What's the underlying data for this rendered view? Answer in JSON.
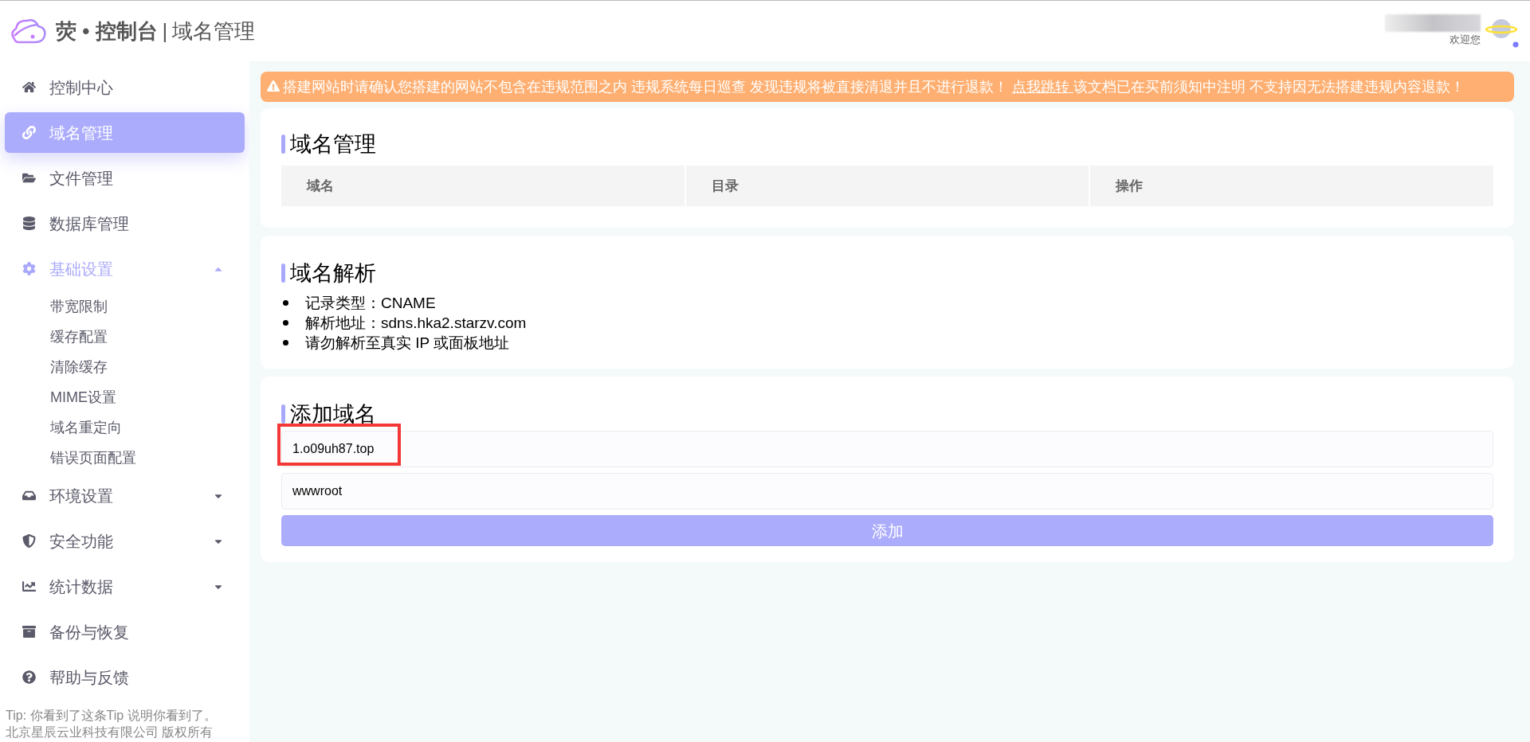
{
  "header": {
    "brand": "荧 • 控制台",
    "separator": "|",
    "page_title": "域名管理",
    "welcome": "欢迎您"
  },
  "sidebar": {
    "items": [
      {
        "kind": "link",
        "label": "控制中心",
        "selected": false
      },
      {
        "kind": "link",
        "label": "域名管理",
        "selected": true
      },
      {
        "kind": "link",
        "label": "文件管理",
        "selected": false
      },
      {
        "kind": "link",
        "label": "数据库管理",
        "selected": false
      },
      {
        "kind": "group",
        "label": "基础设置",
        "selected": false,
        "expanded": true,
        "children": [
          {
            "label": "带宽限制"
          },
          {
            "label": "缓存配置"
          },
          {
            "label": "清除缓存"
          },
          {
            "label": "MIME设置"
          },
          {
            "label": "域名重定向"
          },
          {
            "label": "错误页面配置"
          }
        ]
      },
      {
        "kind": "group",
        "label": "环境设置",
        "selected": false,
        "expanded": false
      },
      {
        "kind": "group",
        "label": "安全功能",
        "selected": false,
        "expanded": false
      },
      {
        "kind": "group",
        "label": "统计数据",
        "selected": false,
        "expanded": false
      },
      {
        "kind": "link",
        "label": "备份与恢复",
        "selected": false
      },
      {
        "kind": "link",
        "label": "帮助与反馈",
        "selected": false
      }
    ],
    "footer": [
      "Tip: 你看到了这条Tip 说明你看到了。",
      "北京星辰云业科技有限公司 版权所有"
    ]
  },
  "notice": {
    "text_before": "搭建网站时请确认您搭建的网站不包含在违规范围之内 违规系统每日巡查 发现违规将被直接清退并且不进行退款！",
    "link": "点我跳转 ",
    "text_after": "该文档已在买前须知中注明 不支持因无法搭建违规内容退款！"
  },
  "domain_table": {
    "title": "域名管理",
    "columns": [
      "域名",
      "目录",
      "操作"
    ]
  },
  "resolve": {
    "title": "域名解析",
    "items": [
      "记录类型：CNAME",
      "解析地址：sdns.hka2.starzv.com",
      "请勿解析至真实 IP 或面板地址"
    ]
  },
  "add_domain": {
    "title": "添加域名",
    "fields": [
      {
        "value": "1.o09uh87.top",
        "highlighted": true
      },
      {
        "value": "wwwroot",
        "highlighted": false
      }
    ],
    "button": "添加"
  }
}
